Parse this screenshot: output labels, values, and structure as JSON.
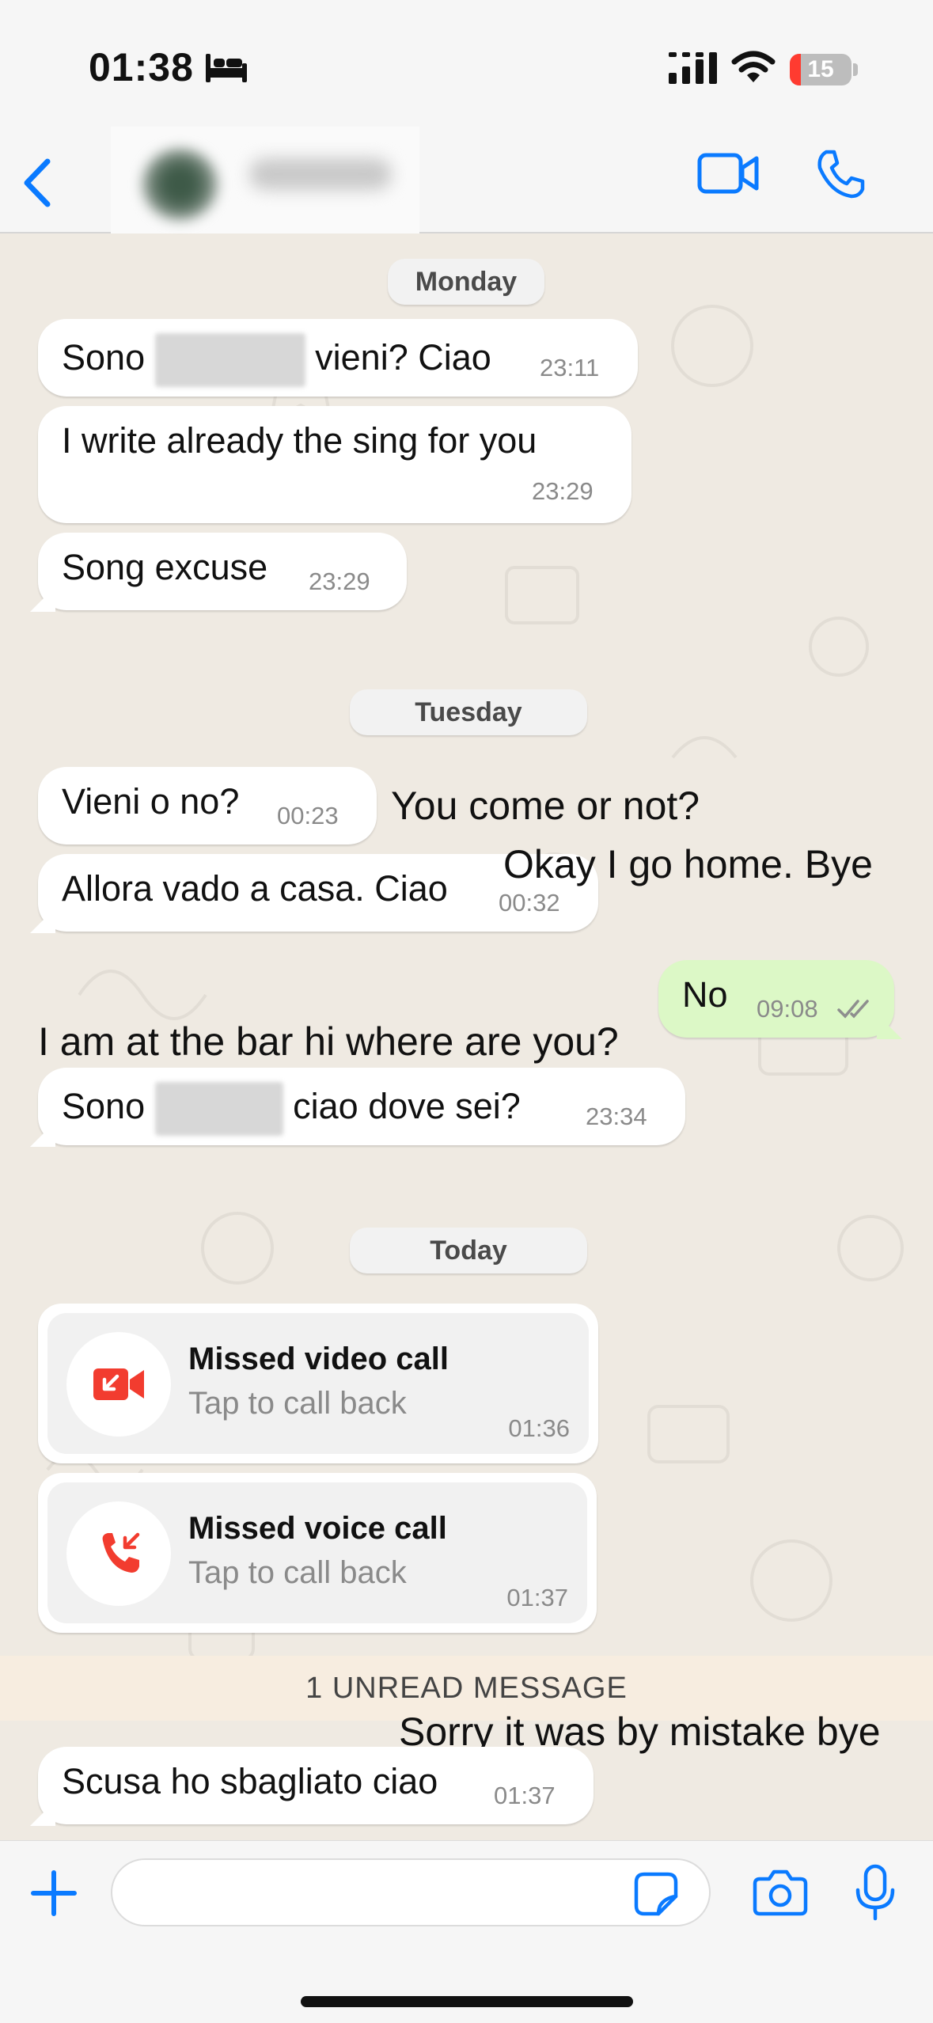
{
  "status_bar": {
    "time": "01:38",
    "battery": "15"
  },
  "header": {
    "back": "Back",
    "contact": "",
    "icons": [
      "video-camera-icon",
      "phone-icon"
    ]
  },
  "chat": {
    "separators": {
      "monday": "Monday",
      "tuesday": "Tuesday",
      "today": "Today"
    },
    "messages": [
      {
        "dir": "in",
        "text_a": "Sono",
        "text_b": "vieni? Ciao",
        "time": "23:11"
      },
      {
        "dir": "in",
        "text": "I write already the sing for you",
        "time": "23:29"
      },
      {
        "dir": "in",
        "text": "Song excuse",
        "time": "23:29"
      },
      {
        "dir": "in",
        "text": "Vieni o no?",
        "time": "00:23"
      },
      {
        "dir": "in",
        "text": "Allora vado a casa. Ciao",
        "time": "00:32"
      },
      {
        "dir": "out",
        "text": "No",
        "time": "09:08"
      },
      {
        "dir": "in",
        "text_a": "Sono",
        "text_b": "ciao dove sei?",
        "time": "23:34"
      },
      {
        "dir": "in",
        "text": "Scusa ho sbagliato ciao",
        "time": "01:37"
      }
    ],
    "calls": [
      {
        "title": "Missed video call",
        "subtitle": "Tap to call back",
        "time": "01:36"
      },
      {
        "title": "Missed voice call",
        "subtitle": "Tap to call back",
        "time": "01:37"
      }
    ],
    "unread_banner": "1 UNREAD MESSAGE",
    "annotations": [
      "You come or not?",
      "Okay I go home. Bye",
      "I am at the bar hi where are you?",
      "Sorry it was by mistake bye"
    ]
  },
  "input": {
    "placeholder": ""
  },
  "colors": {
    "accent": "#0a7aff",
    "outgoing": "#dcf8c6",
    "incoming": "#ffffff",
    "missed": "#f23c2f",
    "wallpaper": "#efeae2"
  }
}
